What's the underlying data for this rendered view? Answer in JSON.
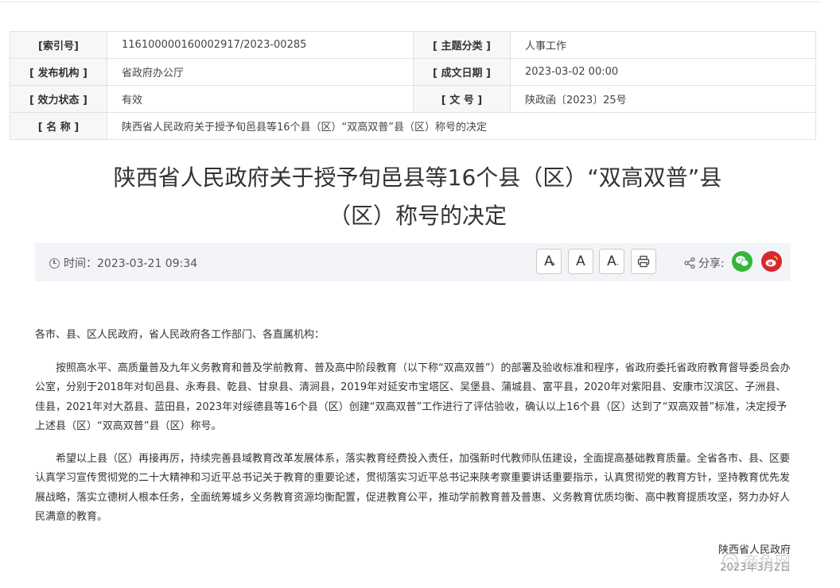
{
  "meta": {
    "index_label": "[索引号]",
    "index_value": "116100000160002917/2023-00285",
    "topic_label": "[ 主题分类 ]",
    "topic_value": "人事工作",
    "issuer_label": "[ 发布机构 ]",
    "issuer_value": "省政府办公厅",
    "created_label": "[ 成文日期 ]",
    "created_value": "2023-03-02 00:00",
    "status_label": "[ 效力状态 ]",
    "status_value": "有效",
    "docno_label": "[ 文 号 ]",
    "docno_value": "陕政函〔2023〕25号",
    "name_label": "[ 名 称 ]",
    "name_value": "陕西省人民政府关于授予旬邑县等16个县（区）“双高双普”县（区）称号的决定"
  },
  "title": {
    "line1": "陕西省人民政府关于授予旬邑县等16个县（区）“双高双普”县",
    "line2": "（区）称号的决定"
  },
  "infobar": {
    "time": "时间：2023-03-21 09:34",
    "font_large": "A",
    "font_medium": "A",
    "font_small": "A",
    "share_label": "分享:",
    "icons": [
      "clock-icon",
      "font-increase-icon",
      "font-default-icon",
      "font-decrease-icon",
      "print-icon",
      "share-icon",
      "wechat-icon",
      "weibo-icon"
    ]
  },
  "body": {
    "salutation": "各市、县、区人民政府，省人民政府各工作部门、各直属机构：",
    "para1": "按照高水平、高质量普及九年义务教育和普及学前教育、普及高中阶段教育（以下称“双高双普”）的部署及验收标准和程序，省政府委托省政府教育督导委员会办公室，分别于2018年对旬邑县、永寿县、乾县、甘泉县、清涧县，2019年对延安市宝塔区、吴堡县、蒲城县、富平县，2020年对紫阳县、安康市汉滨区、子洲县、佳县，2021年对大荔县、蓝田县，2023年对绥德县等16个县（区）创建“双高双普”工作进行了评估验收，确认以上16个县（区）达到了“双高双普”标准，决定授予上述县（区）“双高双普”县（区）称号。",
    "para2": "希望以上县（区）再接再厉，持续完善县域教育改革发展体系，落实教育经费投入责任，加强新时代教师队伍建设，全面提高基础教育质量。全省各市、县、区要认真学习宣传贯彻党的二十大精神和习近平总书记关于教育的重要论述，贯彻落实习近平总书记来陕考察重要讲话重要指示，认真贯彻党的教育方针，坚持教育优先发展战略，落实立德树人根本任务，全面统筹城乡义务教育资源均衡配置，促进教育公平，推动学前教育普及普惠、义务教育优质均衡、高中教育提质攻坚，努力办好人民满意的教育。",
    "signer": "陕西省人民政府",
    "sign_date": "2023年3月2日"
  },
  "watermark": "商鱼网"
}
